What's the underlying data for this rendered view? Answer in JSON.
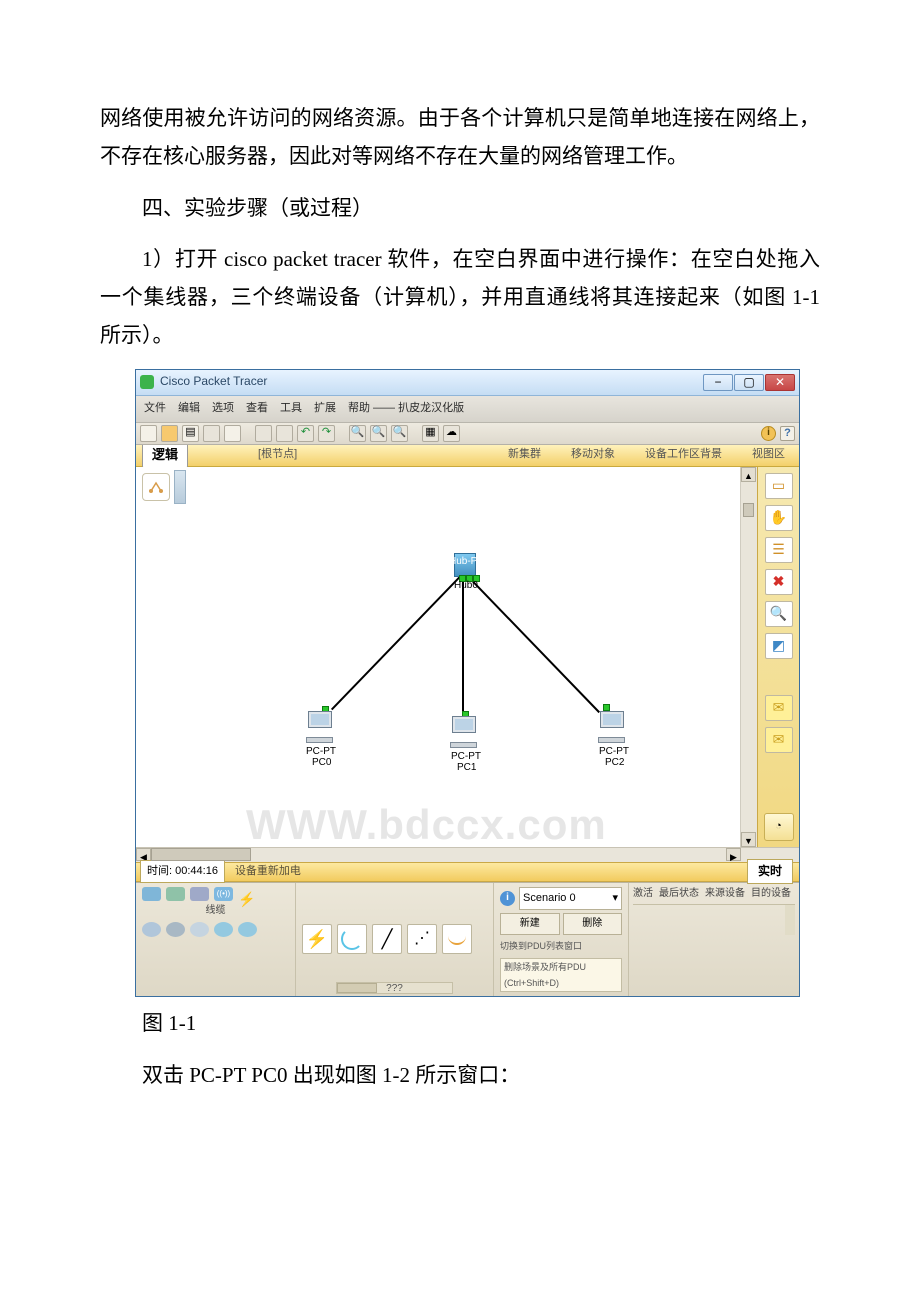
{
  "doc": {
    "p1": "网络使用被允许访问的网络资源。由于各个计算机只是简单地连接在网络上，不存在核心服务器，因此对等网络不存在大量的网络管理工作。",
    "p2": "四、实验步骤（或过程）",
    "p3": "1）打开 cisco packet tracer 软件，在空白界面中进行操作：在空白处拖入一个集线器，三个终端设备（计算机），并用直通线将其连接起来（如图 1-1 所示）。",
    "fig1": "图 1-1",
    "p4": "双击 PC-PT PC0 出现如图 1-2 所示窗口："
  },
  "pt": {
    "title": "Cisco Packet Tracer",
    "menus": [
      "文件",
      "编辑",
      "选项",
      "查看",
      "工具",
      "扩展",
      "帮助 —— 扒皮龙汉化版"
    ],
    "logic": "逻辑",
    "root": "[根节点]",
    "goldRight": [
      "新集群",
      "移动对象",
      "设备工作区背景",
      "视图区"
    ],
    "clock": "时间: 00:44:16",
    "reboot": "设备重新加电",
    "realtime": "实时",
    "hub": {
      "line1": "Hub-PT",
      "line2": "Hub0"
    },
    "pcs": [
      {
        "line1": "PC-PT",
        "line2": "PC0"
      },
      {
        "line1": "PC-PT",
        "line2": "PC1"
      },
      {
        "line1": "PC-PT",
        "line2": "PC2"
      }
    ],
    "watermark": "WWW.bdccx.com",
    "paletteLabel1": "线缆",
    "unknown": "???",
    "scenario": {
      "name": "Scenario 0",
      "new": "新建",
      "del": "删除",
      "switch": "切换到PDU列表窗口",
      "hint": "删除场景及所有PDU (Ctrl+Shift+D)"
    },
    "eventCols": [
      "激活",
      "最后状态",
      "来源设备",
      "目的设备"
    ]
  }
}
